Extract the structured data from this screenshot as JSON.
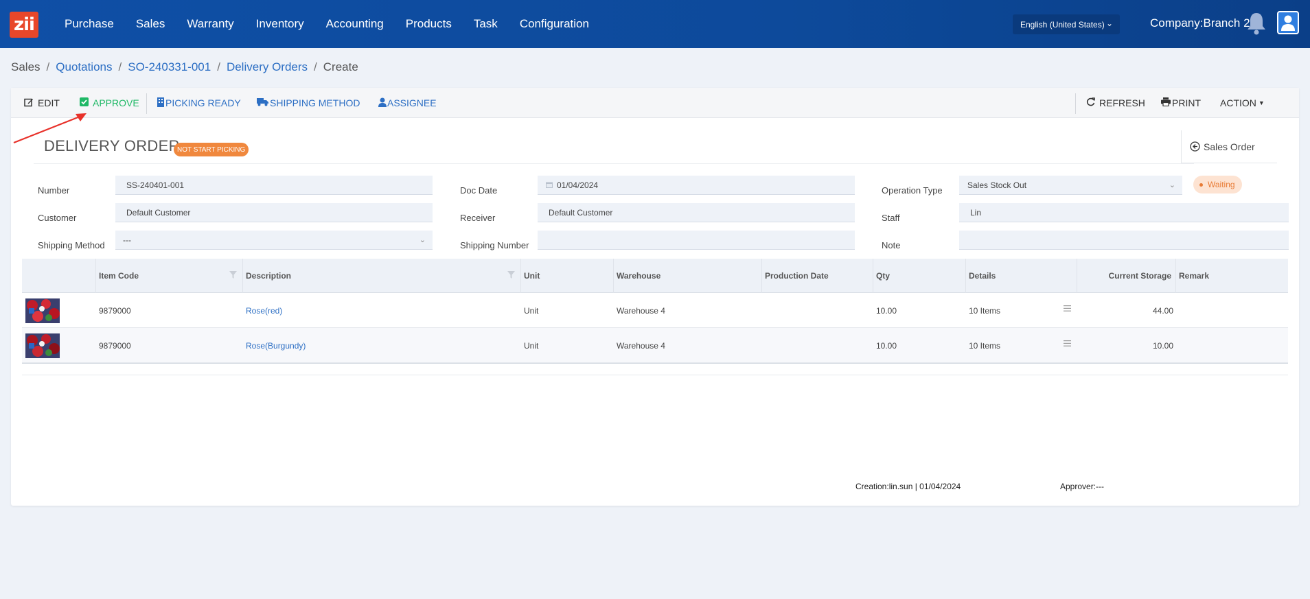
{
  "app": {
    "logo_text": "zii"
  },
  "nav": [
    "Purchase",
    "Sales",
    "Warranty",
    "Inventory",
    "Accounting",
    "Products",
    "Task",
    "Configuration"
  ],
  "header": {
    "language": "English (United States)",
    "company": "Company:Branch 2"
  },
  "breadcrumb": {
    "items": [
      "Sales",
      "Quotations",
      "SO-240331-001",
      "Delivery Orders",
      "Create"
    ]
  },
  "toolbar": {
    "edit": "EDIT",
    "approve": "APPROVE",
    "picking_ready": "PICKING READY",
    "shipping_method": "SHIPPING METHOD",
    "assignee": "ASSIGNEE",
    "refresh": "REFRESH",
    "print": "PRINT",
    "action": "ACTION"
  },
  "colors": {
    "approve": "#1fb866",
    "link": "#2d6fc4",
    "status_pill": "#f0883e",
    "waiting": "#e87b35"
  },
  "doc": {
    "title": "DELIVERY ORDER",
    "picking_status": "NOT START PICKING",
    "sales_order": "Sales Order",
    "state": "Waiting"
  },
  "form": {
    "number_label": "Number",
    "number": "SS-240401-001",
    "customer_label": "Customer",
    "customer": "Default Customer",
    "shipping_method_label": "Shipping Method",
    "shipping_method": "---",
    "doc_date_label": "Doc Date",
    "doc_date": "01/04/2024",
    "receiver_label": "Receiver",
    "receiver": "Default Customer",
    "shipping_number_label": "Shipping Number",
    "shipping_number": "",
    "operation_type_label": "Operation Type",
    "operation_type": "Sales Stock Out",
    "staff_label": "Staff",
    "staff": "Lin",
    "note_label": "Note",
    "note": ""
  },
  "table": {
    "headers": [
      "Item Code",
      "Description",
      "Unit",
      "Warehouse",
      "Production Date",
      "Qty",
      "Details",
      "Current Storage",
      "Remark"
    ],
    "rows": [
      {
        "code": "9879000",
        "desc": "Rose(red)",
        "unit": "Unit",
        "warehouse": "Warehouse 4",
        "prod_date": "",
        "qty": "10.00",
        "details": "10 Items",
        "storage": "44.00",
        "remark": ""
      },
      {
        "code": "9879000",
        "desc": "Rose(Burgundy)",
        "unit": "Unit",
        "warehouse": "Warehouse 4",
        "prod_date": "",
        "qty": "10.00",
        "details": "10 Items",
        "storage": "10.00",
        "remark": ""
      }
    ]
  },
  "footer": {
    "creation": "Creation:lin.sun | 01/04/2024",
    "approver": "Approver:---"
  }
}
